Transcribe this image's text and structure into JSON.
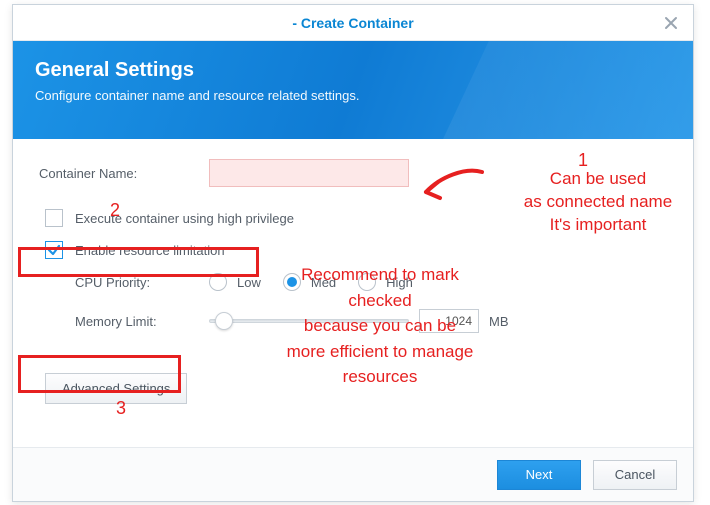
{
  "window": {
    "title": "- Create Container"
  },
  "banner": {
    "heading": "General Settings",
    "sub": "Configure container name and resource related settings."
  },
  "form": {
    "container_name_label": "Container Name:",
    "container_name_value": "",
    "high_privilege_label": "Execute container using high privilege",
    "high_privilege_checked": false,
    "resource_limit_label": "Enable resource limitation",
    "resource_limit_checked": true,
    "cpu_priority_label": "CPU Priority:",
    "cpu_priority_options": {
      "low": "Low",
      "med": "Med",
      "high": "High"
    },
    "cpu_priority_selected": "med",
    "memory_limit_label": "Memory Limit:",
    "memory_limit_value": "1024",
    "memory_limit_unit": "MB",
    "advanced_settings_label": "Advanced Settings"
  },
  "footer": {
    "next": "Next",
    "cancel": "Cancel"
  },
  "annotations": {
    "num1": "1",
    "num2": "2",
    "num3": "3",
    "tip1_line1": "Can be used",
    "tip1_line2": "as connected name",
    "tip1_line3": "It's important",
    "tip2_line1": "Recommend to mark",
    "tip2_line2": "checked",
    "tip2_line3": "because you can be",
    "tip2_line4": "more efficient to manage",
    "tip2_line5": "resources"
  }
}
